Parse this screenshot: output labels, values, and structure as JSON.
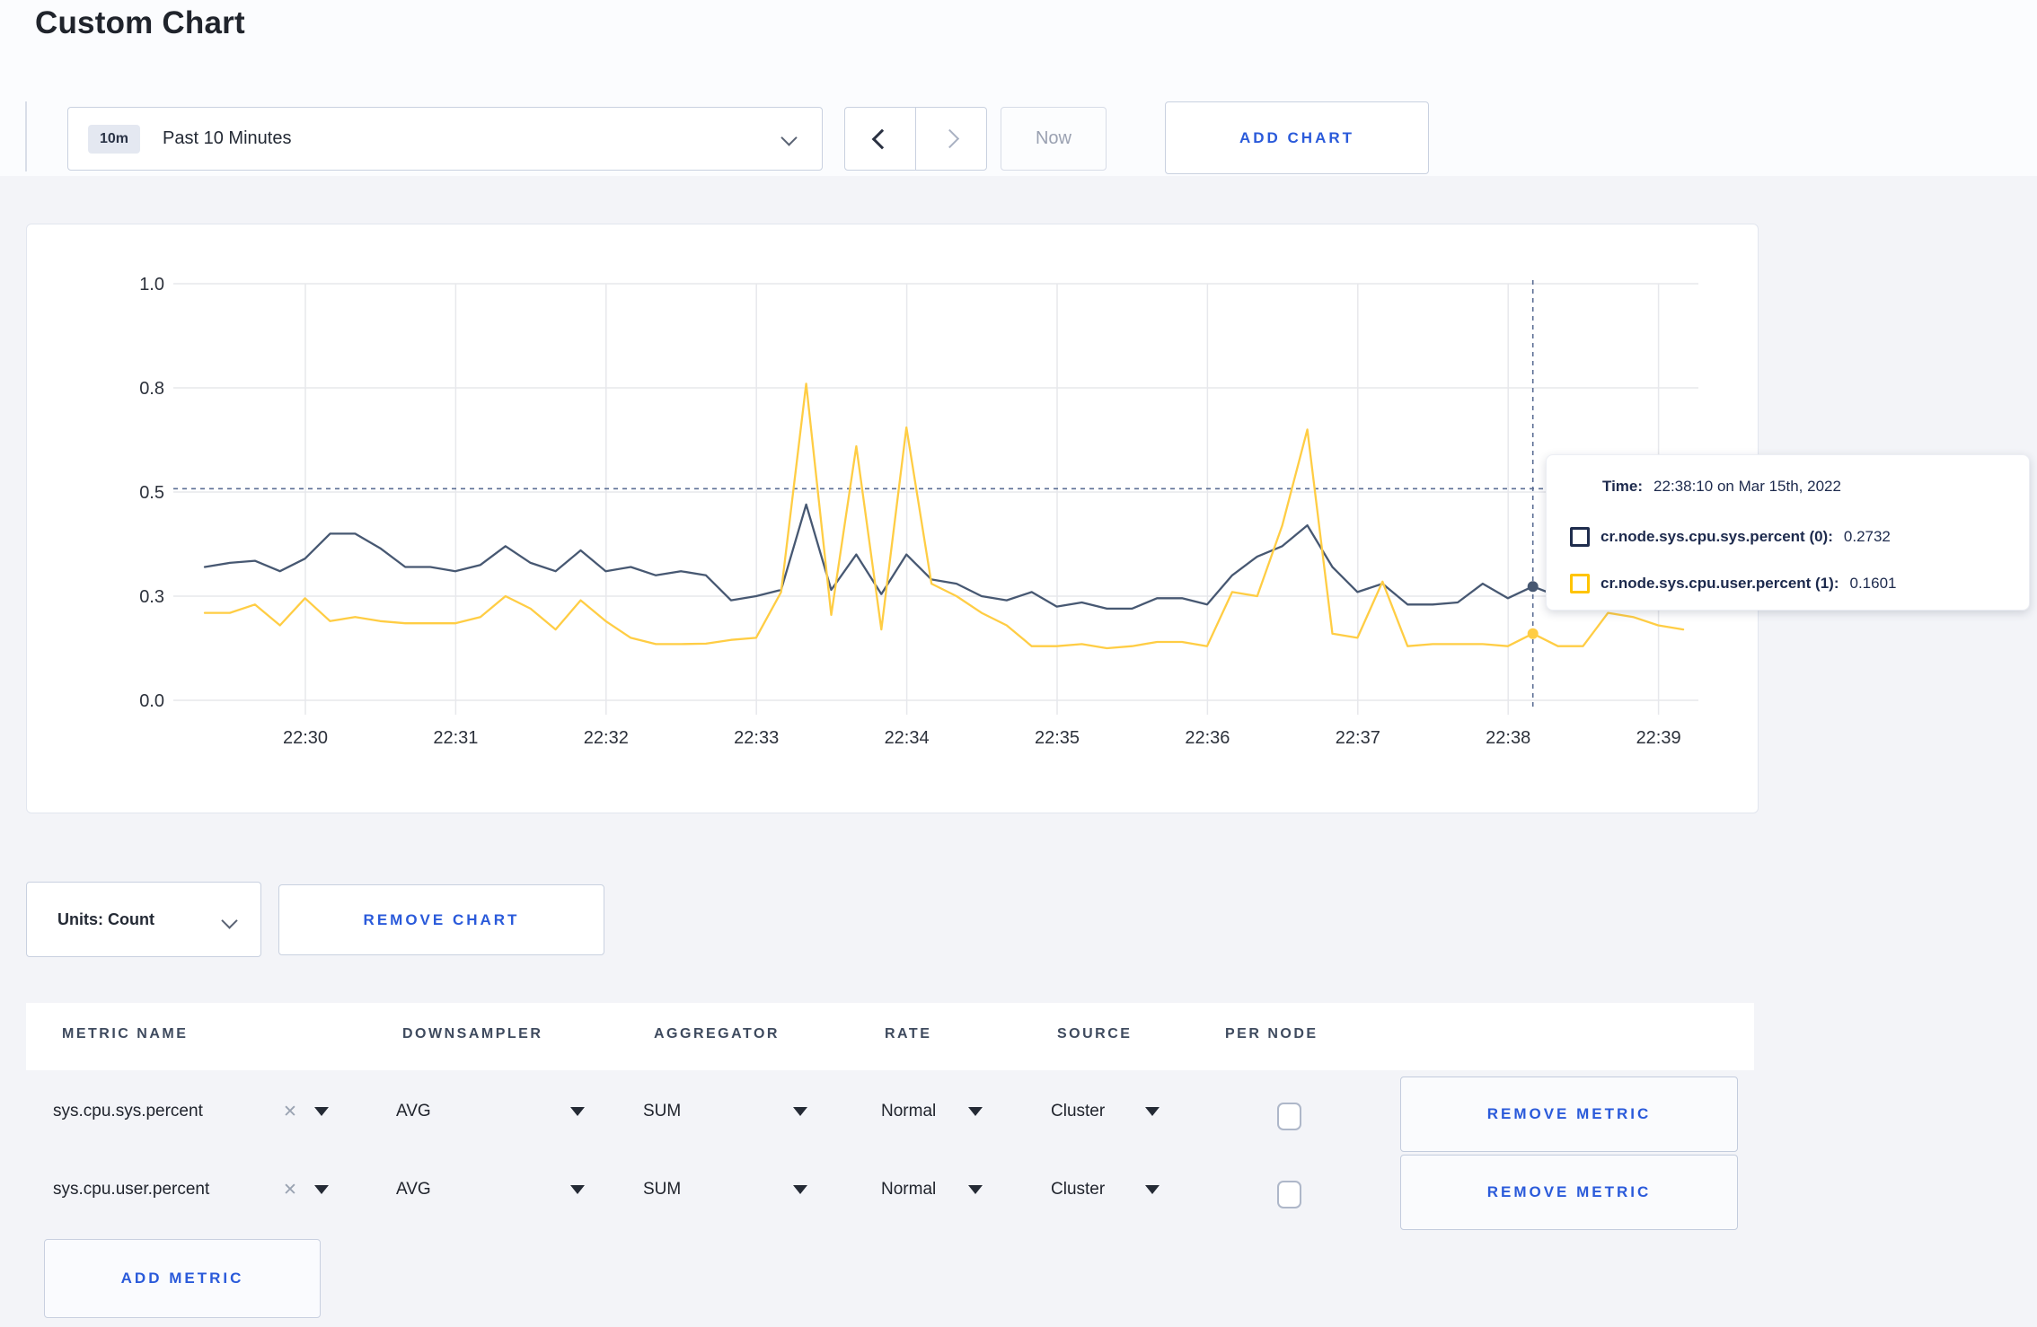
{
  "page": {
    "title": "Custom Chart"
  },
  "toolbar": {
    "time_badge": "10m",
    "time_label": "Past 10 Minutes",
    "now_label": "Now",
    "add_chart_label": "ADD CHART"
  },
  "tooltip": {
    "time_label": "Time:",
    "time_value": "22:38:10 on Mar 15th, 2022",
    "rows": [
      {
        "name": "cr.node.sys.cpu.sys.percent (0):",
        "value": "0.2732",
        "color": "#1f2d4d"
      },
      {
        "name": "cr.node.sys.cpu.user.percent (1):",
        "value": "0.1601",
        "color": "#ffc400"
      }
    ]
  },
  "units": {
    "label": "Units: Count",
    "remove_chart_label": "REMOVE CHART"
  },
  "table": {
    "headers": [
      "METRIC NAME",
      "DOWNSAMPLER",
      "AGGREGATOR",
      "RATE",
      "SOURCE",
      "PER NODE"
    ],
    "clear_icon": "✕",
    "remove_metric_label": "REMOVE METRIC",
    "add_metric_label": "ADD METRIC",
    "rows": [
      {
        "metric": "sys.cpu.sys.percent",
        "downsampler": "AVG",
        "aggregator": "SUM",
        "rate": "Normal",
        "source": "Cluster",
        "per_node_checked": false
      },
      {
        "metric": "sys.cpu.user.percent",
        "downsampler": "AVG",
        "aggregator": "SUM",
        "rate": "Normal",
        "source": "Cluster",
        "per_node_checked": false
      }
    ]
  },
  "chart_data": {
    "type": "line",
    "title": "",
    "xlabel": "",
    "ylabel": "",
    "ylim": [
      0,
      1
    ],
    "grid": true,
    "legend_position": "none",
    "y_tick_labels": [
      "0.0",
      "0.3",
      "0.5",
      "0.8",
      "1.0"
    ],
    "y_tick_values": [
      0,
      0.25,
      0.5,
      0.75,
      1.0
    ],
    "x_tick_labels": [
      "22:30",
      "22:31",
      "22:32",
      "22:33",
      "22:34",
      "22:35",
      "22:36",
      "22:37",
      "22:38",
      "22:39"
    ],
    "times": [
      "22:29:20",
      "22:29:30",
      "22:29:40",
      "22:29:50",
      "22:30:00",
      "22:30:10",
      "22:30:20",
      "22:30:30",
      "22:30:40",
      "22:30:50",
      "22:31:00",
      "22:31:10",
      "22:31:20",
      "22:31:30",
      "22:31:40",
      "22:31:50",
      "22:32:00",
      "22:32:10",
      "22:32:20",
      "22:32:30",
      "22:32:40",
      "22:32:50",
      "22:33:00",
      "22:33:10",
      "22:33:20",
      "22:33:30",
      "22:33:40",
      "22:33:50",
      "22:34:00",
      "22:34:10",
      "22:34:20",
      "22:34:30",
      "22:34:40",
      "22:34:50",
      "22:35:00",
      "22:35:10",
      "22:35:20",
      "22:35:30",
      "22:35:40",
      "22:35:50",
      "22:36:00",
      "22:36:10",
      "22:36:20",
      "22:36:30",
      "22:36:40",
      "22:36:50",
      "22:37:00",
      "22:37:10",
      "22:37:20",
      "22:37:30",
      "22:37:40",
      "22:37:50",
      "22:38:00",
      "22:38:10",
      "22:38:20",
      "22:38:30",
      "22:38:40",
      "22:38:50",
      "22:39:00",
      "22:39:10"
    ],
    "series": [
      {
        "name": "cr.node.sys.cpu.sys.percent",
        "color": "#475872",
        "values": [
          0.32,
          0.33,
          0.335,
          0.31,
          0.34,
          0.4,
          0.4,
          0.365,
          0.32,
          0.32,
          0.31,
          0.325,
          0.37,
          0.33,
          0.31,
          0.36,
          0.31,
          0.32,
          0.3,
          0.31,
          0.3,
          0.24,
          0.25,
          0.265,
          0.47,
          0.265,
          0.35,
          0.255,
          0.35,
          0.29,
          0.28,
          0.25,
          0.24,
          0.26,
          0.225,
          0.235,
          0.22,
          0.22,
          0.245,
          0.245,
          0.23,
          0.3,
          0.345,
          0.37,
          0.42,
          0.32,
          0.26,
          0.28,
          0.23,
          0.23,
          0.235,
          0.28,
          0.245,
          0.2732,
          0.25,
          0.25,
          0.26,
          0.25,
          0.26,
          0.25
        ]
      },
      {
        "name": "cr.node.sys.cpu.user.percent",
        "color": "#ffcd44",
        "values": [
          0.21,
          0.21,
          0.23,
          0.18,
          0.245,
          0.19,
          0.2,
          0.19,
          0.185,
          0.185,
          0.185,
          0.2,
          0.25,
          0.22,
          0.17,
          0.24,
          0.19,
          0.15,
          0.135,
          0.135,
          0.136,
          0.145,
          0.15,
          0.26,
          0.76,
          0.205,
          0.61,
          0.17,
          0.655,
          0.28,
          0.25,
          0.21,
          0.18,
          0.13,
          0.13,
          0.135,
          0.125,
          0.13,
          0.14,
          0.14,
          0.13,
          0.26,
          0.25,
          0.42,
          0.65,
          0.16,
          0.15,
          0.285,
          0.13,
          0.135,
          0.135,
          0.135,
          0.13,
          0.1601,
          0.13,
          0.13,
          0.21,
          0.2,
          0.18,
          0.17
        ]
      }
    ],
    "hover": {
      "index": 53,
      "time": "22:38:10",
      "crosshair_value": 0.508
    }
  }
}
